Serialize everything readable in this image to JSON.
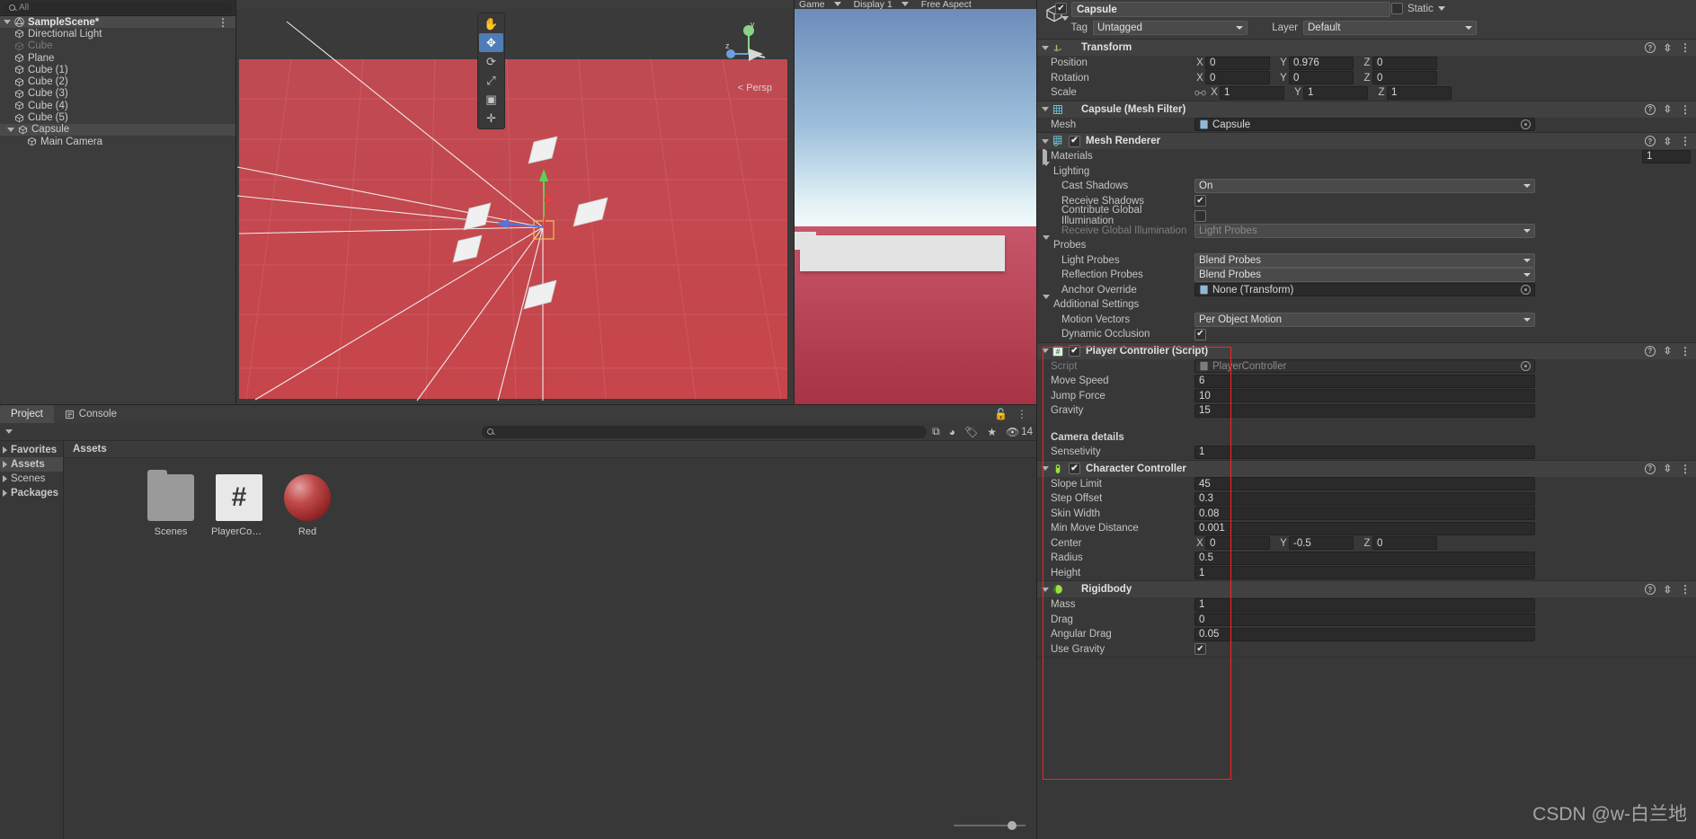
{
  "hierarchy": {
    "search_placeholder": "All",
    "scene_name": "SampleScene*",
    "items": [
      {
        "label": "Directional Light",
        "indent": 1,
        "dim": false,
        "selected": false,
        "expandable": false
      },
      {
        "label": "Cube",
        "indent": 1,
        "dim": true,
        "selected": false,
        "expandable": false
      },
      {
        "label": "Plane",
        "indent": 1,
        "dim": false,
        "selected": false,
        "expandable": false
      },
      {
        "label": "Cube (1)",
        "indent": 1,
        "dim": false,
        "selected": false,
        "expandable": false
      },
      {
        "label": "Cube (2)",
        "indent": 1,
        "dim": false,
        "selected": false,
        "expandable": false
      },
      {
        "label": "Cube (3)",
        "indent": 1,
        "dim": false,
        "selected": false,
        "expandable": false
      },
      {
        "label": "Cube (4)",
        "indent": 1,
        "dim": false,
        "selected": false,
        "expandable": false
      },
      {
        "label": "Cube (5)",
        "indent": 1,
        "dim": false,
        "selected": false,
        "expandable": false
      },
      {
        "label": "Capsule",
        "indent": 1,
        "dim": false,
        "selected": true,
        "expandable": true
      },
      {
        "label": "Main Camera",
        "indent": 2,
        "dim": false,
        "selected": false,
        "expandable": false
      }
    ]
  },
  "scene_view": {
    "persp_label": "< Persp",
    "gizmo_axes": {
      "y": "y",
      "z": "z",
      "x": "x"
    },
    "tools": [
      {
        "name": "hand-tool",
        "glyph": "✋",
        "active": false
      },
      {
        "name": "move-tool",
        "glyph": "✥",
        "active": true
      },
      {
        "name": "rotate-tool",
        "glyph": "⟳",
        "active": false
      },
      {
        "name": "scale-tool",
        "glyph": "⤢",
        "active": false
      },
      {
        "name": "rect-tool",
        "glyph": "▣",
        "active": false
      },
      {
        "name": "transform-tool",
        "glyph": "✛",
        "active": false
      }
    ]
  },
  "game_view": {
    "tab_label": "Game",
    "display": "Display 1",
    "aspect": "Free Aspect"
  },
  "project": {
    "tabs": [
      {
        "label": "Project",
        "active": true
      },
      {
        "label": "Console",
        "active": false
      }
    ],
    "search_placeholder": "",
    "hidden_count": "14",
    "tree": [
      {
        "label": "Favorites",
        "header": true,
        "selected": false
      },
      {
        "label": "Assets",
        "header": true,
        "selected": true
      },
      {
        "label": "Scenes",
        "header": false,
        "selected": false
      },
      {
        "label": "Packages",
        "header": true,
        "selected": false
      }
    ],
    "breadcrumb": "Assets",
    "assets": [
      {
        "label": "Scenes",
        "kind": "folder"
      },
      {
        "label": "PlayerCont...",
        "kind": "csharp",
        "glyph": "#"
      },
      {
        "label": "Red",
        "kind": "material"
      }
    ]
  },
  "inspector": {
    "object_name": "Capsule",
    "object_enabled": true,
    "static_label": "Static",
    "tag_label": "Tag",
    "tag_value": "Untagged",
    "layer_label": "Layer",
    "layer_value": "Default",
    "components": [
      {
        "name": "Transform",
        "icon": "transform-icon",
        "has_checkbox": false,
        "rows": [
          {
            "label": "Position",
            "type": "vector3",
            "x": "0",
            "y": "0.976",
            "z": "0"
          },
          {
            "label": "Rotation",
            "type": "vector3",
            "x": "0",
            "y": "0",
            "z": "0"
          },
          {
            "label": "Scale",
            "type": "vector3",
            "x": "1",
            "y": "1",
            "z": "1",
            "linked": true
          }
        ]
      },
      {
        "name": "Capsule (Mesh Filter)",
        "icon": "mesh-filter-icon",
        "has_checkbox": false,
        "rows": [
          {
            "label": "Mesh",
            "type": "object",
            "value": "Capsule"
          }
        ]
      },
      {
        "name": "Mesh Renderer",
        "icon": "mesh-renderer-icon",
        "has_checkbox": true,
        "checked": true,
        "rows": [
          {
            "label": "Materials",
            "type": "foldout-count",
            "value": "1",
            "collapsed": true
          },
          {
            "label": "Lighting",
            "type": "foldout",
            "expanded": true
          },
          {
            "label": "Cast Shadows",
            "type": "dropdown",
            "value": "On",
            "indent": 2
          },
          {
            "label": "Receive Shadows",
            "type": "checkbox",
            "value": true,
            "indent": 2
          },
          {
            "label": "Contribute Global Illumination",
            "type": "checkbox",
            "value": false,
            "indent": 2
          },
          {
            "label": "Receive Global Illumination",
            "type": "dropdown",
            "value": "Light Probes",
            "indent": 2,
            "disabled": true
          },
          {
            "label": "Probes",
            "type": "foldout",
            "expanded": true
          },
          {
            "label": "Light Probes",
            "type": "dropdown",
            "value": "Blend Probes",
            "indent": 2
          },
          {
            "label": "Reflection Probes",
            "type": "dropdown",
            "value": "Blend Probes",
            "indent": 2
          },
          {
            "label": "Anchor Override",
            "type": "object",
            "value": "None (Transform)",
            "indent": 2
          },
          {
            "label": "Additional Settings",
            "type": "foldout",
            "expanded": true
          },
          {
            "label": "Motion Vectors",
            "type": "dropdown",
            "value": "Per Object Motion",
            "indent": 2
          },
          {
            "label": "Dynamic Occlusion",
            "type": "checkbox",
            "value": true,
            "indent": 2
          }
        ]
      },
      {
        "name": "Player Controller (Script)",
        "icon": "csharp-script-icon",
        "has_checkbox": true,
        "checked": true,
        "rows": [
          {
            "label": "Script",
            "type": "object",
            "value": "PlayerController",
            "disabled": true
          },
          {
            "label": "Move Speed",
            "type": "number",
            "value": "6"
          },
          {
            "label": "Jump Force",
            "type": "number",
            "value": "10"
          },
          {
            "label": "Gravity",
            "type": "number",
            "value": "15"
          },
          {
            "label": "",
            "type": "spacer"
          },
          {
            "label": "Camera details",
            "type": "header"
          },
          {
            "label": "Sensetivity",
            "type": "number",
            "value": "1"
          }
        ]
      },
      {
        "name": "Character Controller",
        "icon": "character-controller-icon",
        "has_checkbox": true,
        "checked": true,
        "rows": [
          {
            "label": "Slope Limit",
            "type": "number",
            "value": "45"
          },
          {
            "label": "Step Offset",
            "type": "number",
            "value": "0.3"
          },
          {
            "label": "Skin Width",
            "type": "number",
            "value": "0.08"
          },
          {
            "label": "Min Move Distance",
            "type": "number",
            "value": "0.001"
          },
          {
            "label": "Center",
            "type": "vector3",
            "x": "0",
            "y": "-0.5",
            "z": "0"
          },
          {
            "label": "Radius",
            "type": "number",
            "value": "0.5"
          },
          {
            "label": "Height",
            "type": "number",
            "value": "1"
          }
        ]
      },
      {
        "name": "Rigidbody",
        "icon": "rigidbody-icon",
        "has_checkbox": false,
        "rows": [
          {
            "label": "Mass",
            "type": "number",
            "value": "1"
          },
          {
            "label": "Drag",
            "type": "number",
            "value": "0"
          },
          {
            "label": "Angular Drag",
            "type": "number",
            "value": "0.05"
          },
          {
            "label": "Use Gravity",
            "type": "checkbox",
            "value": true
          }
        ]
      }
    ],
    "highlight_color": "#ff2020"
  },
  "watermark": "CSDN @w-白兰地"
}
